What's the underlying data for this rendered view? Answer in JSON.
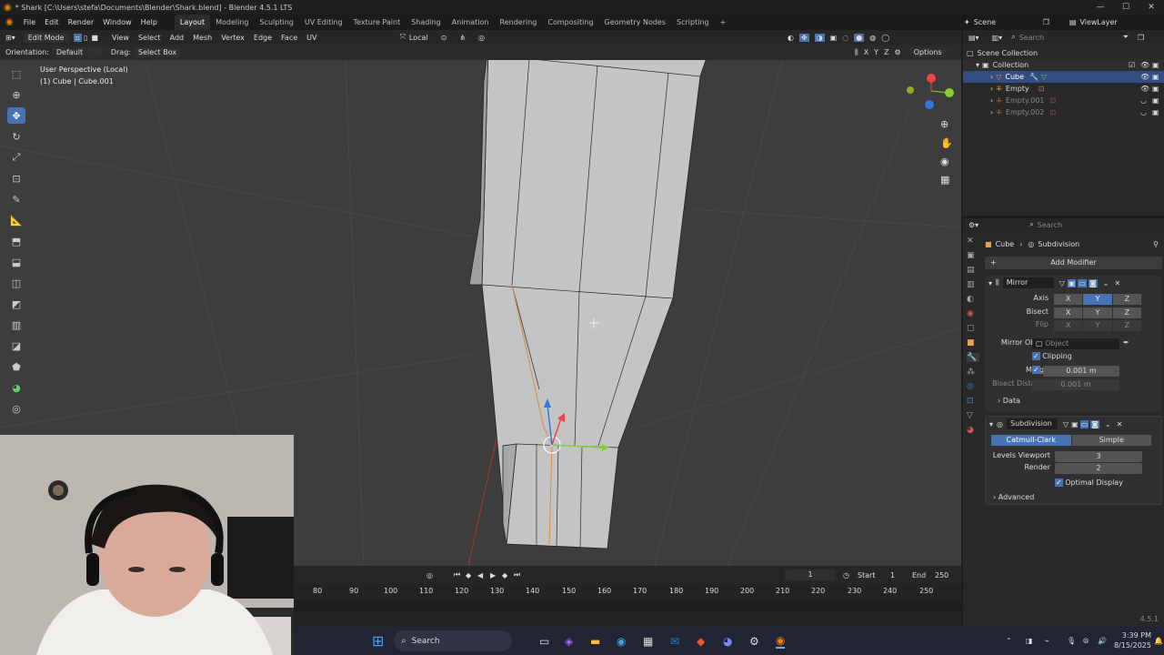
{
  "window": {
    "title": "* Shark [C:\\Users\\stefa\\Documents\\Blender\\Shark.blend] - Blender 4.5.1 LTS"
  },
  "menu": [
    "File",
    "Edit",
    "Render",
    "Window",
    "Help"
  ],
  "workspaces": [
    "Layout",
    "Modeling",
    "Sculpting",
    "UV Editing",
    "Texture Paint",
    "Shading",
    "Animation",
    "Rendering",
    "Compositing",
    "Geometry Nodes",
    "Scripting"
  ],
  "active_workspace": "Layout",
  "scene": {
    "label": "Scene",
    "view_layer": "ViewLayer"
  },
  "header3d": {
    "mode": "Edit Mode",
    "menus": [
      "View",
      "Select",
      "Add",
      "Mesh",
      "Vertex",
      "Edge",
      "Face",
      "UV"
    ],
    "transform": "Local"
  },
  "toolhdr": {
    "orientation_label": "Orientation:",
    "orientation_value": "Default",
    "drag_label": "Drag:",
    "drag_value": "Select Box",
    "axes": [
      "X",
      "Y",
      "Z"
    ],
    "options": "Options"
  },
  "viewport": {
    "view_name": "User Perspective (Local)",
    "object_info": "(1) Cube | Cube.001"
  },
  "timeline": {
    "frame": "1",
    "start_label": "Start",
    "start": "1",
    "end_label": "End",
    "end": "250",
    "ticks": [
      "80",
      "90",
      "100",
      "110",
      "120",
      "130",
      "140",
      "150",
      "160",
      "170",
      "180",
      "190",
      "200",
      "210",
      "220",
      "230",
      "240",
      "250"
    ]
  },
  "outliner": {
    "search_placeholder": "Search",
    "root": "Scene Collection",
    "collection": "Collection",
    "items": [
      {
        "name": "Cube",
        "selected": true
      },
      {
        "name": "Empty",
        "selected": false
      },
      {
        "name": "Empty.001",
        "selected": false
      },
      {
        "name": "Empty.002",
        "selected": false
      }
    ]
  },
  "properties": {
    "search_placeholder": "Search",
    "breadcrumb_object": "Cube",
    "breadcrumb_modifier": "Subdivision",
    "add_modifier": "Add Modifier",
    "mirror": {
      "name": "Mirror",
      "axis_label": "Axis",
      "bisect_label": "Bisect",
      "flip_label": "Flip",
      "axes": [
        "X",
        "Y",
        "Z"
      ],
      "mirror_object_label": "Mirror Object",
      "mirror_object_placeholder": "Object",
      "clipping_label": "Clipping",
      "merge_label": "Merge",
      "merge_value": "0.001 m",
      "bisect_distance_label": "Bisect Distance",
      "bisect_distance_value": "0.001 m",
      "data_label": "Data"
    },
    "subdivision": {
      "name": "Subdivision",
      "type_catmull": "Catmull-Clark",
      "type_simple": "Simple",
      "levels_viewport_label": "Levels Viewport",
      "levels_viewport_value": "3",
      "render_label": "Render",
      "render_value": "2",
      "optimal_display_label": "Optimal Display",
      "advanced_label": "Advanced"
    }
  },
  "status": {
    "version": "4.5.1"
  },
  "taskbar": {
    "search": "Search",
    "time": "3:39 PM",
    "date": "8/15/2025"
  },
  "colors": {
    "accent": "#4772b3",
    "viewport_bg": "#3d3d3d",
    "mesh": "#c9c9c9",
    "selected_edge": "#e08a3c"
  }
}
